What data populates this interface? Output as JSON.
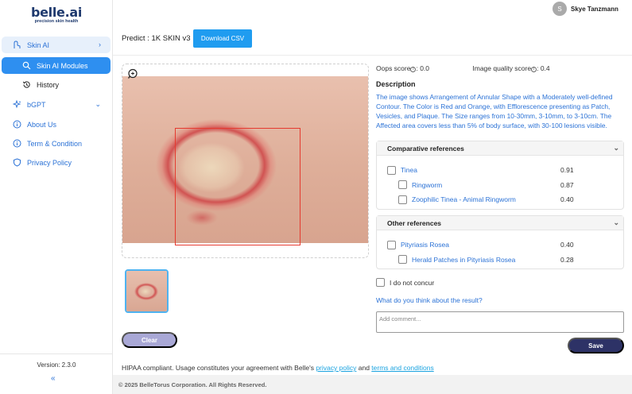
{
  "brand": {
    "name": "belle.ai",
    "tagline": "precision skin health"
  },
  "sidebar": {
    "items": [
      {
        "label": "Skin AI",
        "icon": "skin-icon",
        "expanded": true
      },
      {
        "label": "Skin AI Modules",
        "icon": "search-icon",
        "active": true
      },
      {
        "label": "History",
        "icon": "history-icon"
      },
      {
        "label": "bGPT",
        "icon": "sparkle-icon"
      },
      {
        "label": "About Us",
        "icon": "info-icon"
      },
      {
        "label": "Term & Condition",
        "icon": "info-icon"
      },
      {
        "label": "Privacy Policy",
        "icon": "shield-icon"
      }
    ],
    "version": "Version: 2.3.0"
  },
  "user": {
    "initial": "S",
    "name": "Skye Tanzmann"
  },
  "header": {
    "predict_title": "Predict : 1K SKIN v3",
    "download_label": "Download CSV"
  },
  "scores": {
    "oops_label": "Oops score",
    "oops_value": ": 0.0",
    "quality_label": "Image quality score",
    "quality_value": ": 0.4"
  },
  "description": {
    "title": "Description",
    "text": "The image shows Arrangement of Annular Shape with a Moderately well-defined Contour. The Color is Red and Orange, with Efflorescence presenting as Patch, Vesicles, and Plaque. The Size ranges from 10-30mm, 3-10mm, to 3-10cm. The Affected area covers less than 5% of body surface, with 30-100 lesions visible."
  },
  "comparative": {
    "title": "Comparative references",
    "items": [
      {
        "label": "Tinea",
        "value": "0.91",
        "level": 0
      },
      {
        "label": "Ringworm",
        "value": "0.87",
        "level": 1
      },
      {
        "label": "Zoophilic Tinea - Animal Ringworm",
        "value": "0.40",
        "level": 1
      }
    ]
  },
  "other": {
    "title": "Other references",
    "items": [
      {
        "label": "Pityriasis Rosea",
        "value": "0.40",
        "level": 0
      },
      {
        "label": "Herald Patches in Pityriasis Rosea",
        "value": "0.28",
        "level": 1
      }
    ]
  },
  "feedback": {
    "concur_label": "I do not concur",
    "question": "What do you think about the result?",
    "comment_placeholder": "Add comment...",
    "save_label": "Save",
    "clear_label": "Clear"
  },
  "hipaa": {
    "prefix": "HIPAA compliant. Usage constitutes your agreement with Belle's",
    "privacy_link": "privacy policy",
    "and": "and",
    "terms_link": "terms and conditions"
  },
  "footer": {
    "copyright": "© 2025 BelleTorus Corporation. All Rights Reserved."
  }
}
